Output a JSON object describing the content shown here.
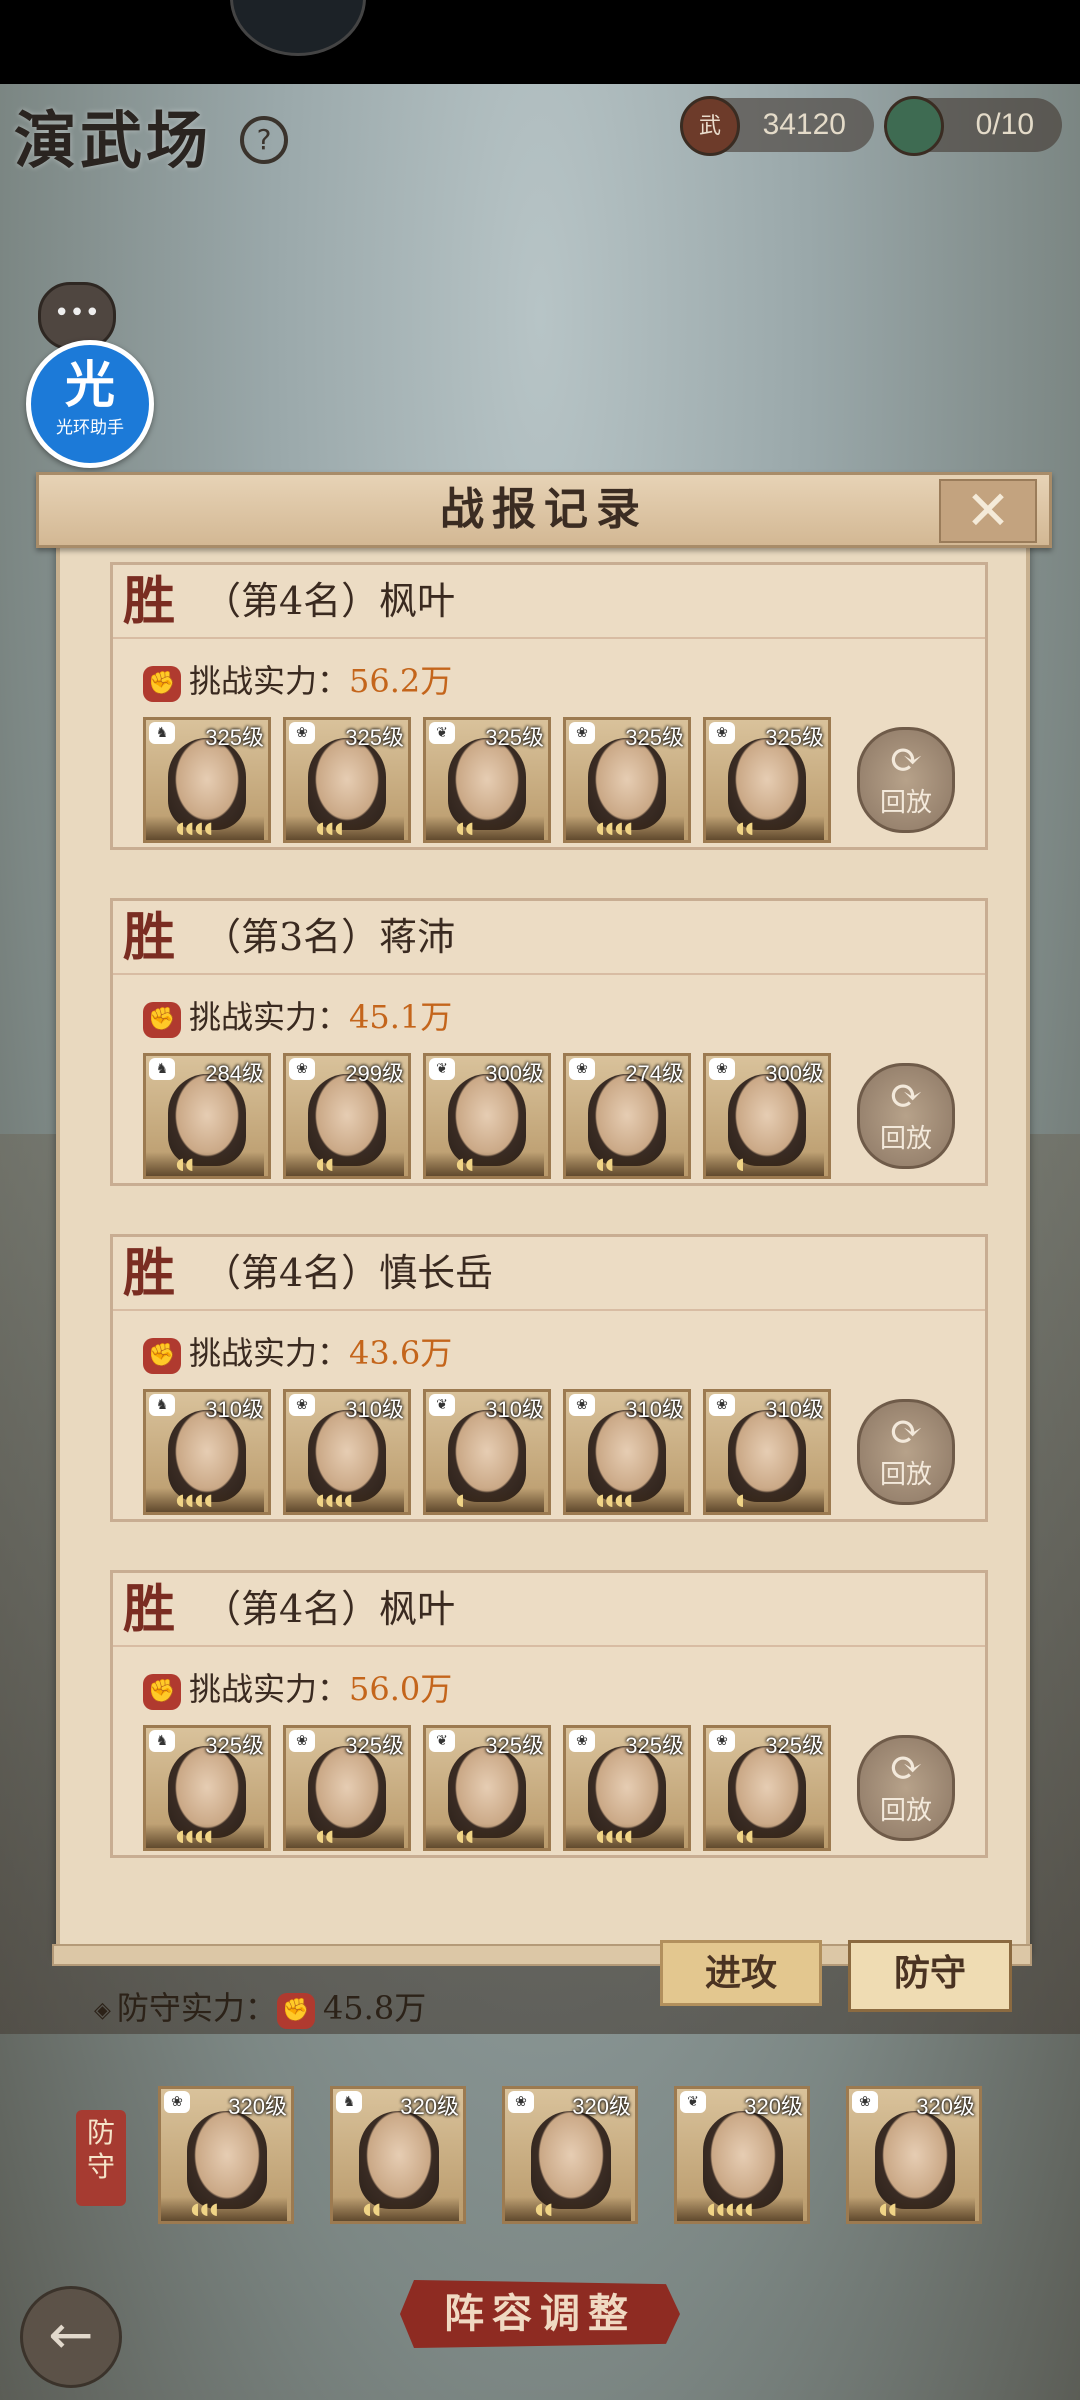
{
  "header": {
    "title": "演武场",
    "help_icon": "?",
    "coins": "34120",
    "coin_icon": "武",
    "tickets": "0/10"
  },
  "overlay": {
    "chat_dots": "•••",
    "helper_big": "光",
    "helper_small": "光环助手"
  },
  "panel": {
    "title": "战报记录",
    "close": "✕",
    "win_label": "胜",
    "power_label": "挑战实力：",
    "replay_label": "回放",
    "replay_symbol": "⟳",
    "records": [
      {
        "opponent": "（第4名）枫叶",
        "power": "56.2万",
        "heroes": [
          {
            "level": "325级",
            "stars": "◖◖◖◖"
          },
          {
            "level": "325级",
            "stars": "◖◖◖"
          },
          {
            "level": "325级",
            "stars": "◖◖"
          },
          {
            "level": "325级",
            "stars": "◖◖◖◖"
          },
          {
            "level": "325级",
            "stars": "◖◖"
          }
        ]
      },
      {
        "opponent": "（第3名）蒋沛",
        "power": "45.1万",
        "heroes": [
          {
            "level": "284级",
            "stars": "◖◖"
          },
          {
            "level": "299级",
            "stars": "◖◖"
          },
          {
            "level": "300级",
            "stars": "◖◖"
          },
          {
            "level": "274级",
            "stars": "◖◖"
          },
          {
            "level": "300级",
            "stars": "◖"
          }
        ]
      },
      {
        "opponent": "（第4名）慎长岳",
        "power": "43.6万",
        "heroes": [
          {
            "level": "310级",
            "stars": "◖◖◖◖"
          },
          {
            "level": "310级",
            "stars": "◖◖◖◖"
          },
          {
            "level": "310级",
            "stars": "◖"
          },
          {
            "level": "310级",
            "stars": "◖◖◖◖"
          },
          {
            "level": "310级",
            "stars": "◖"
          }
        ]
      },
      {
        "opponent": "（第4名）枫叶",
        "power": "56.0万",
        "heroes": [
          {
            "level": "325级",
            "stars": "◖◖◖◖"
          },
          {
            "level": "325级",
            "stars": "◖◖"
          },
          {
            "level": "325级",
            "stars": "◖◖"
          },
          {
            "level": "325级",
            "stars": "◖◖◖◖"
          },
          {
            "level": "325级",
            "stars": "◖◖"
          }
        ]
      }
    ]
  },
  "tabs": {
    "attack": "进攻",
    "defense": "防守"
  },
  "defense": {
    "power_label": "防守实力：",
    "power": "45.8万",
    "label": "防守",
    "heroes": [
      {
        "level": "320级",
        "stars": "◖◖◖"
      },
      {
        "level": "320级",
        "stars": "◖◖"
      },
      {
        "level": "320级",
        "stars": "◖◖"
      },
      {
        "level": "320级",
        "stars": "◖◖◖◖◖"
      },
      {
        "level": "320级",
        "stars": "◖◖"
      }
    ]
  },
  "footer": {
    "formation": "阵容调整",
    "back_icon": "←"
  },
  "colors": {
    "accent": "#c4651b",
    "badge": "#7a2d22",
    "button_red": "#8e2b22"
  }
}
